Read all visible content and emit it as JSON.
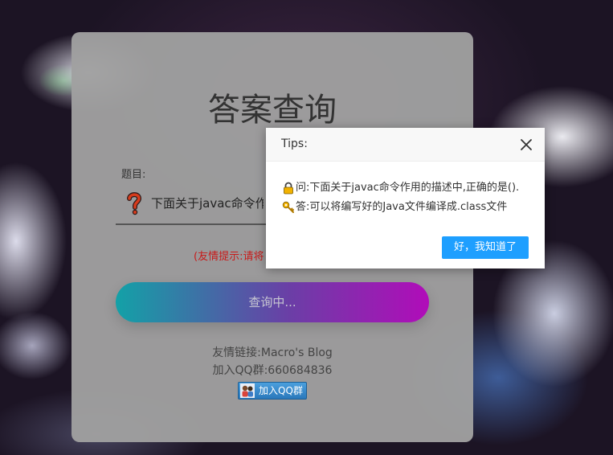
{
  "page": {
    "title": "答案查询",
    "question_label": "题目:",
    "question_value": "下面关于javac命令作用的描述中,正确的是().",
    "tip": "(友情提示:请将",
    "query_button": "查询中...",
    "friend_link": "友情链接:Macro's Blog",
    "qq_group": "加入QQ群:660684836",
    "join_qq_button": "加入QQ群"
  },
  "dialog": {
    "title": "Tips:",
    "question": "问:下面关于javac命令作用的描述中,正确的是().",
    "answer": "答:可以将编写好的Java文件编译成.class文件",
    "ok_button": "好，我知道了"
  },
  "colors": {
    "card_bg": "#a0a0a0",
    "tip_red": "#c81a1a",
    "button_gradient_start": "#13a1a7",
    "button_gradient_end": "#b10cb9",
    "ok_blue": "#1e9fff"
  },
  "icons": [
    "question-mark-icon",
    "lock-icon",
    "key-icon",
    "close-icon",
    "qq-group-icon"
  ]
}
